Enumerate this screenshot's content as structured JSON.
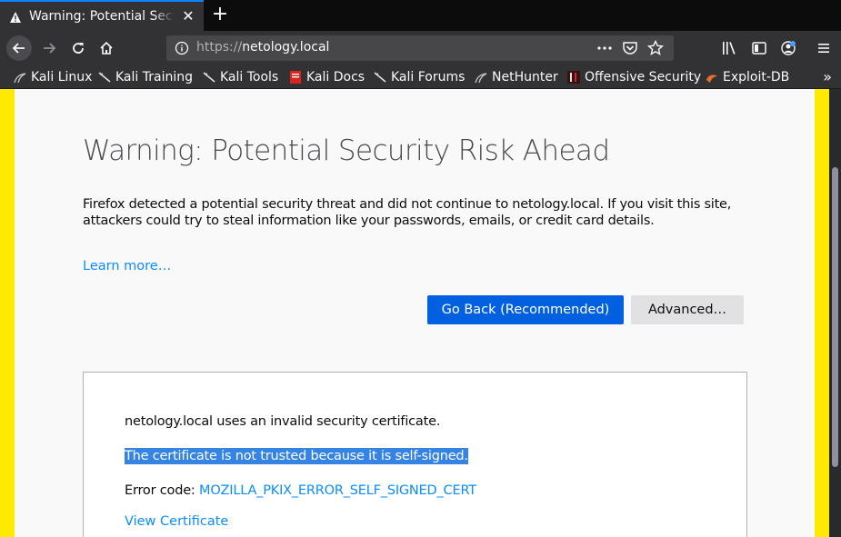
{
  "tab": {
    "title": "Warning: Potential Security Risk Ahead",
    "icon": "warning-icon",
    "close_icon": "close-icon"
  },
  "newtab": {
    "label": "+"
  },
  "navbar": {
    "url_protocol": "https://",
    "url_host": "netology.local",
    "page_actions": [
      "more-icon",
      "pocket-icon",
      "bookmark-star-icon"
    ],
    "right_icons": [
      "library-icon",
      "sidebar-icon",
      "account-icon",
      "menu-icon"
    ]
  },
  "bookmarks": [
    {
      "label": "Kali Linux",
      "icon": "kali-icon"
    },
    {
      "label": "Kali Training",
      "icon": "kali-icon"
    },
    {
      "label": "Kali Tools",
      "icon": "kali-icon"
    },
    {
      "label": "Kali Docs",
      "icon": "docs-icon"
    },
    {
      "label": "Kali Forums",
      "icon": "kali-icon"
    },
    {
      "label": "NetHunter",
      "icon": "nethunter-icon"
    },
    {
      "label": "Offensive Security",
      "icon": "offsec-icon"
    },
    {
      "label": "Exploit-DB",
      "icon": "exploitdb-icon"
    }
  ],
  "bookmarks_more": "»",
  "page": {
    "title": "Warning: Potential Security Risk Ahead",
    "description": "Firefox detected a potential security threat and did not continue to netology.local. If you visit this site, attackers could try to steal information like your passwords, emails, or credit card details.",
    "learn_more": "Learn more…",
    "go_back": "Go Back (Recommended)",
    "advanced": "Advanced…",
    "advanced_panel": {
      "line1": "netology.local uses an invalid security certificate.",
      "line2": "The certificate is not trusted because it is self-signed.",
      "error_prefix": "Error code: ",
      "error_code": "MOZILLA_PKIX_ERROR_SELF_SIGNED_CERT",
      "view_certificate": "View Certificate"
    }
  },
  "colors": {
    "accent": "#0060df",
    "link": "#0a8dff",
    "warning_edge": "#ffe900",
    "selection": "#3584e4"
  }
}
